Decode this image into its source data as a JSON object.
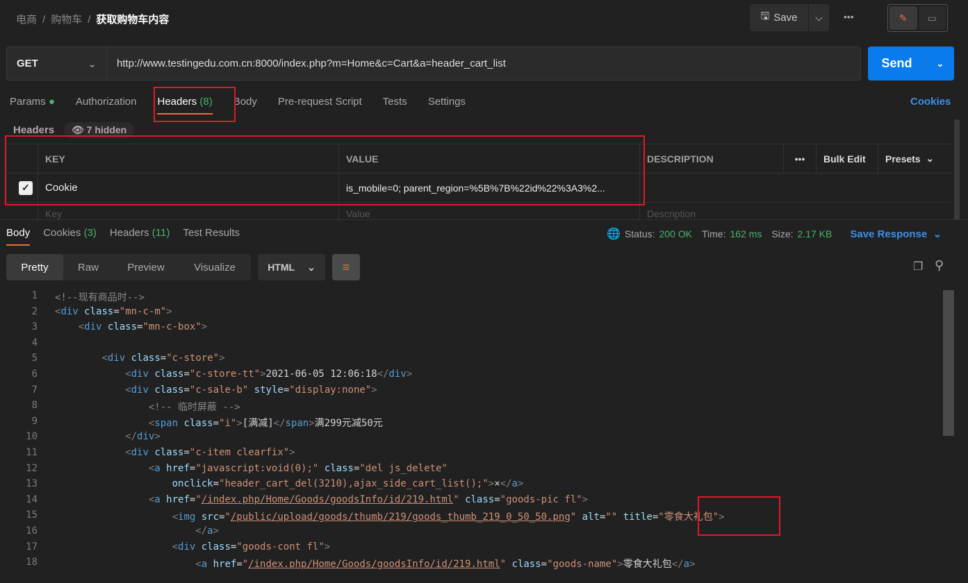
{
  "breadcrumb": {
    "items": [
      "电商",
      "购物车"
    ],
    "current": "获取购物车内容"
  },
  "toolbar": {
    "save": "Save"
  },
  "request": {
    "method": "GET",
    "url": "http://www.testingedu.com.cn:8000/index.php?m=Home&c=Cart&a=header_cart_list",
    "send": "Send"
  },
  "req_tabs": [
    {
      "label": "Params"
    },
    {
      "label": "Authorization"
    },
    {
      "label": "Headers",
      "count": "(8)"
    },
    {
      "label": "Body"
    },
    {
      "label": "Pre-request Script"
    },
    {
      "label": "Tests"
    },
    {
      "label": "Settings"
    }
  ],
  "cookies_link": "Cookies",
  "headers": {
    "title": "Headers",
    "hidden": "7 hidden",
    "columns": [
      "KEY",
      "VALUE",
      "DESCRIPTION"
    ],
    "bulk_edit": "Bulk Edit",
    "presets": "Presets",
    "rows": [
      {
        "checked": true,
        "key": "Cookie",
        "value": "is_mobile=0; parent_region=%5B%7B%22id%22%3A3%2..."
      }
    ],
    "placeholders": {
      "key": "Key",
      "value": "Value",
      "description": "Description"
    }
  },
  "resp_tabs": [
    {
      "label": "Body"
    },
    {
      "label": "Cookies",
      "count": "(3)"
    },
    {
      "label": "Headers",
      "count": "(11)"
    },
    {
      "label": "Test Results"
    }
  ],
  "status": {
    "status_label": "Status:",
    "status": "200 OK",
    "time_label": "Time:",
    "time": "162 ms",
    "size_label": "Size:",
    "size": "2.17 KB",
    "save_response": "Save Response"
  },
  "view": {
    "modes": [
      "Pretty",
      "Raw",
      "Preview",
      "Visualize"
    ],
    "active": "Pretty",
    "format": "HTML"
  },
  "code": [
    [
      [
        "c",
        "<!--现有商品时-->"
      ]
    ],
    [
      [
        "b",
        "<"
      ],
      [
        "n",
        "div"
      ],
      [
        "x",
        " "
      ],
      [
        "a",
        "class"
      ],
      [
        "x",
        "="
      ],
      [
        "s",
        "\"mn-c-m\""
      ],
      [
        "b",
        ">"
      ]
    ],
    [
      [
        "x",
        "    "
      ],
      [
        "b",
        "<"
      ],
      [
        "n",
        "div"
      ],
      [
        "x",
        " "
      ],
      [
        "a",
        "class"
      ],
      [
        "x",
        "="
      ],
      [
        "s",
        "\"mn-c-box\""
      ],
      [
        "b",
        ">"
      ]
    ],
    [],
    [
      [
        "x",
        "        "
      ],
      [
        "b",
        "<"
      ],
      [
        "n",
        "div"
      ],
      [
        "x",
        " "
      ],
      [
        "a",
        "class"
      ],
      [
        "x",
        "="
      ],
      [
        "s",
        "\"c-store\""
      ],
      [
        "b",
        ">"
      ]
    ],
    [
      [
        "x",
        "            "
      ],
      [
        "b",
        "<"
      ],
      [
        "n",
        "div"
      ],
      [
        "x",
        " "
      ],
      [
        "a",
        "class"
      ],
      [
        "x",
        "="
      ],
      [
        "s",
        "\"c-store-tt\""
      ],
      [
        "b",
        ">"
      ],
      [
        "x",
        "2021-06-05 12:06:18"
      ],
      [
        "b",
        "</"
      ],
      [
        "n",
        "div"
      ],
      [
        "b",
        ">"
      ]
    ],
    [
      [
        "x",
        "            "
      ],
      [
        "b",
        "<"
      ],
      [
        "n",
        "div"
      ],
      [
        "x",
        " "
      ],
      [
        "a",
        "class"
      ],
      [
        "x",
        "="
      ],
      [
        "s",
        "\"c-sale-b\""
      ],
      [
        "x",
        " "
      ],
      [
        "a",
        "style"
      ],
      [
        "x",
        "="
      ],
      [
        "s",
        "\"display:none\""
      ],
      [
        "b",
        ">"
      ]
    ],
    [
      [
        "x",
        "                "
      ],
      [
        "c",
        "<!-- 临时屏蔽 -->"
      ]
    ],
    [
      [
        "x",
        "                "
      ],
      [
        "b",
        "<"
      ],
      [
        "n",
        "span"
      ],
      [
        "x",
        " "
      ],
      [
        "a",
        "class"
      ],
      [
        "x",
        "="
      ],
      [
        "s",
        "\"i\""
      ],
      [
        "b",
        ">"
      ],
      [
        "x",
        "[满减]"
      ],
      [
        "b",
        "</"
      ],
      [
        "n",
        "span"
      ],
      [
        "b",
        ">"
      ],
      [
        "x",
        "满299元减50元"
      ]
    ],
    [
      [
        "x",
        "            "
      ],
      [
        "b",
        "</"
      ],
      [
        "n",
        "div"
      ],
      [
        "b",
        ">"
      ]
    ],
    [
      [
        "x",
        "            "
      ],
      [
        "b",
        "<"
      ],
      [
        "n",
        "div"
      ],
      [
        "x",
        " "
      ],
      [
        "a",
        "class"
      ],
      [
        "x",
        "="
      ],
      [
        "s",
        "\"c-item clearfix\""
      ],
      [
        "b",
        ">"
      ]
    ],
    [
      [
        "x",
        "                "
      ],
      [
        "b",
        "<"
      ],
      [
        "n",
        "a"
      ],
      [
        "x",
        " "
      ],
      [
        "a",
        "href"
      ],
      [
        "x",
        "="
      ],
      [
        "s",
        "\"javascript:void(0);\""
      ],
      [
        "x",
        " "
      ],
      [
        "a",
        "class"
      ],
      [
        "x",
        "="
      ],
      [
        "s",
        "\"del js_delete\""
      ]
    ],
    [
      [
        "x",
        "                    "
      ],
      [
        "a",
        "onclick"
      ],
      [
        "x",
        "="
      ],
      [
        "s",
        "\"header_cart_del(3210),ajax_side_cart_list();\""
      ],
      [
        "b",
        ">"
      ],
      [
        "x",
        "×"
      ],
      [
        "b",
        "</"
      ],
      [
        "n",
        "a"
      ],
      [
        "b",
        ">"
      ]
    ],
    [
      [
        "x",
        "                "
      ],
      [
        "b",
        "<"
      ],
      [
        "n",
        "a"
      ],
      [
        "x",
        " "
      ],
      [
        "a",
        "href"
      ],
      [
        "x",
        "="
      ],
      [
        "s",
        "\""
      ],
      [
        "u",
        "/index.php/Home/Goods/goodsInfo/id/219.html"
      ],
      [
        "s",
        "\""
      ],
      [
        "x",
        " "
      ],
      [
        "a",
        "class"
      ],
      [
        "x",
        "="
      ],
      [
        "s",
        "\"goods-pic fl\""
      ],
      [
        "b",
        ">"
      ]
    ],
    [
      [
        "x",
        "                    "
      ],
      [
        "b",
        "<"
      ],
      [
        "n",
        "img"
      ],
      [
        "x",
        " "
      ],
      [
        "a",
        "src"
      ],
      [
        "x",
        "="
      ],
      [
        "s",
        "\""
      ],
      [
        "u",
        "/public/upload/goods/thumb/219/goods_thumb_219_0_50_50.png"
      ],
      [
        "s",
        "\""
      ],
      [
        "x",
        " "
      ],
      [
        "a",
        "alt"
      ],
      [
        "x",
        "="
      ],
      [
        "s",
        "\"\""
      ],
      [
        "x",
        " "
      ],
      [
        "a",
        "title"
      ],
      [
        "x",
        "="
      ],
      [
        "s",
        "\"零食大礼包\""
      ],
      [
        "b",
        ">"
      ]
    ],
    [
      [
        "x",
        "                        "
      ],
      [
        "b",
        "</"
      ],
      [
        "n",
        "a"
      ],
      [
        "b",
        ">"
      ]
    ],
    [
      [
        "x",
        "                    "
      ],
      [
        "b",
        "<"
      ],
      [
        "n",
        "div"
      ],
      [
        "x",
        " "
      ],
      [
        "a",
        "class"
      ],
      [
        "x",
        "="
      ],
      [
        "s",
        "\"goods-cont fl\""
      ],
      [
        "b",
        ">"
      ]
    ],
    [
      [
        "x",
        "                        "
      ],
      [
        "b",
        "<"
      ],
      [
        "n",
        "a"
      ],
      [
        "x",
        " "
      ],
      [
        "a",
        "href"
      ],
      [
        "x",
        "="
      ],
      [
        "s",
        "\""
      ],
      [
        "u",
        "/index.php/Home/Goods/goodsInfo/id/219.html"
      ],
      [
        "s",
        "\""
      ],
      [
        "x",
        " "
      ],
      [
        "a",
        "class"
      ],
      [
        "x",
        "="
      ],
      [
        "s",
        "\"goods-name\""
      ],
      [
        "b",
        ">"
      ],
      [
        "x",
        "零食大礼包"
      ],
      [
        "b",
        "</"
      ],
      [
        "n",
        "a"
      ],
      [
        "b",
        ">"
      ]
    ]
  ]
}
